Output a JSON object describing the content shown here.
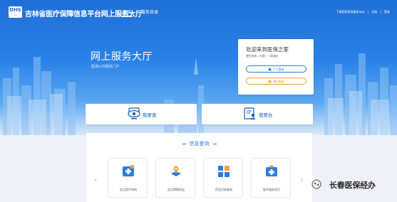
{
  "header": {
    "logo_text": "DHS",
    "site_title": "吉林省医疗保障信息平台网上服务大厅",
    "nav": {
      "home": "首页",
      "catalog": "服务目录"
    },
    "top_links": {
      "download": "下载国家医保服务app",
      "register": "注册",
      "login": "登录"
    }
  },
  "hero": {
    "title": "网上服务大厅",
    "subtitle": "医保公共服务门户"
  },
  "login_card": {
    "title": "欢迎来到医保之家",
    "subtitle": "便民查询 / 办理 / 一网通办",
    "personal_login": "个人登录",
    "unit_login": "单位登录"
  },
  "actions": {
    "check": "我要查",
    "do": "我要办"
  },
  "info": {
    "title": "信息查询",
    "tiles": [
      {
        "label": "定点医疗机构",
        "icon": "hospital-icon"
      },
      {
        "label": "定点零售药店",
        "icon": "pharmacy-map-icon"
      },
      {
        "label": "药品目录查询",
        "icon": "drug-catalog-icon"
      },
      {
        "label": "医疗服务项目",
        "icon": "medical-service-icon"
      }
    ]
  },
  "watermark": {
    "text": "长春医保经办"
  },
  "colors": {
    "primary": "#2b7be0",
    "hero_top": "#1f6fd6",
    "unit_accent": "#f0a030"
  }
}
